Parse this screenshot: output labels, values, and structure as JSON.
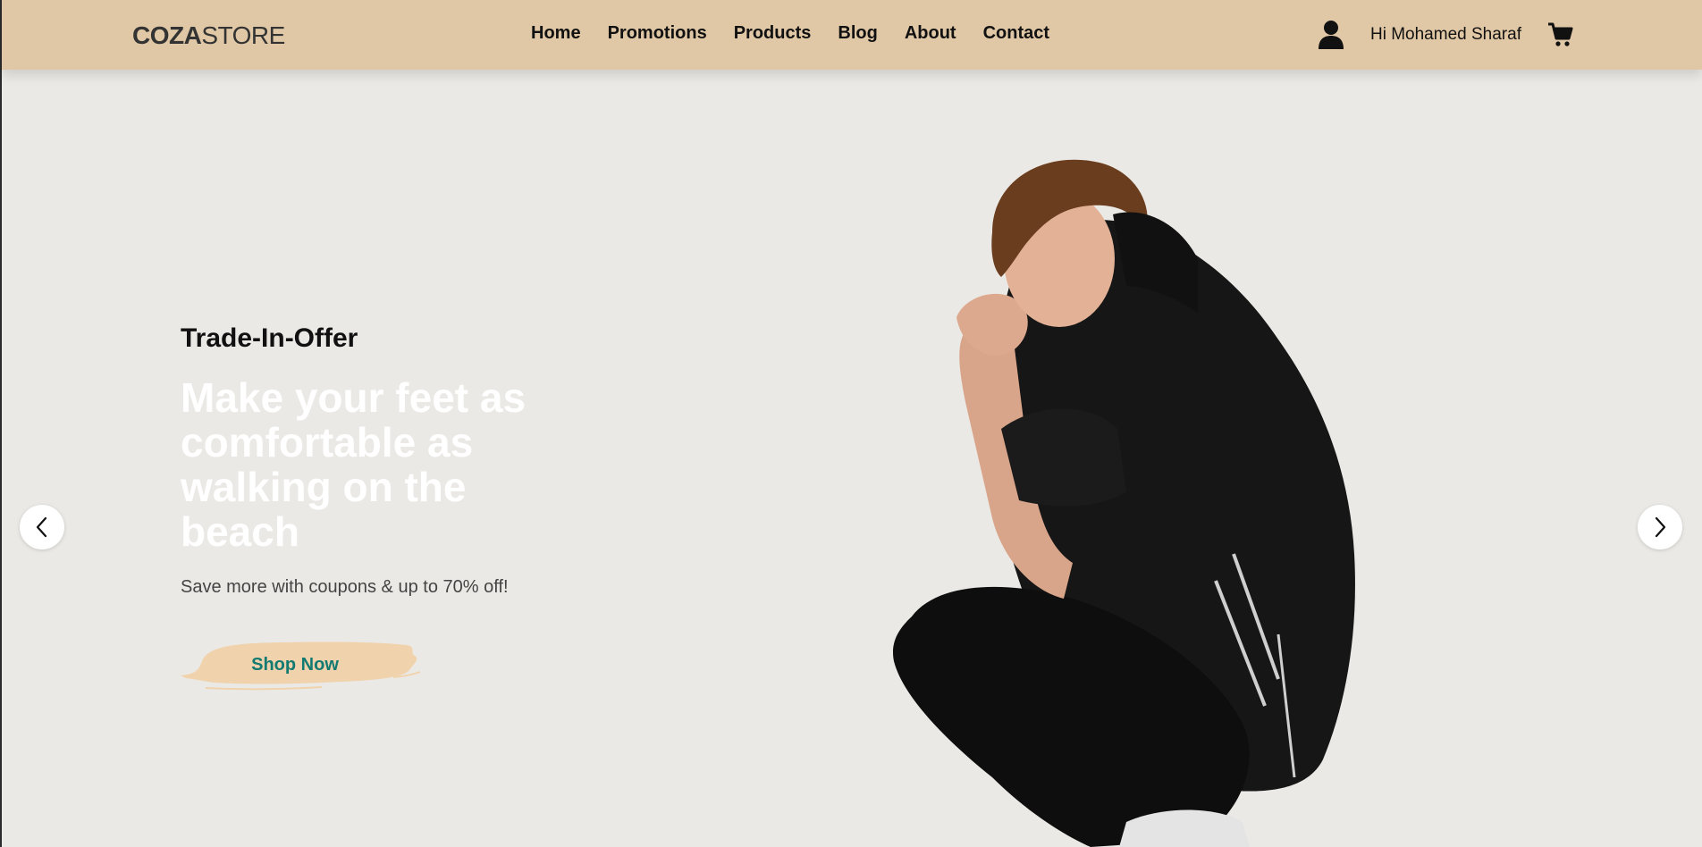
{
  "header": {
    "logo_bold": "COZA",
    "logo_light": "STORE",
    "nav": [
      {
        "label": "Home"
      },
      {
        "label": "Promotions"
      },
      {
        "label": "Products"
      },
      {
        "label": "Blog"
      },
      {
        "label": "About"
      },
      {
        "label": "Contact"
      }
    ],
    "greeting": "Hi Mohamed Sharaf",
    "icons": {
      "user": "user-icon",
      "cart": "cart-icon"
    }
  },
  "hero": {
    "eyebrow": "Trade-In-Offer",
    "title": "Make your feet as comfortable as walking on the beach",
    "subtitle": "Save more with coupons & up to 70% off!",
    "button_label": "Shop Now"
  },
  "carousel": {
    "prev_icon": "chevron-left-icon",
    "next_icon": "chevron-right-icon"
  },
  "colors": {
    "header_bg": "#e0c7a5",
    "page_bg": "#ebe9e5",
    "button_bg": "#f0d3ad",
    "button_text": "#127a70"
  }
}
